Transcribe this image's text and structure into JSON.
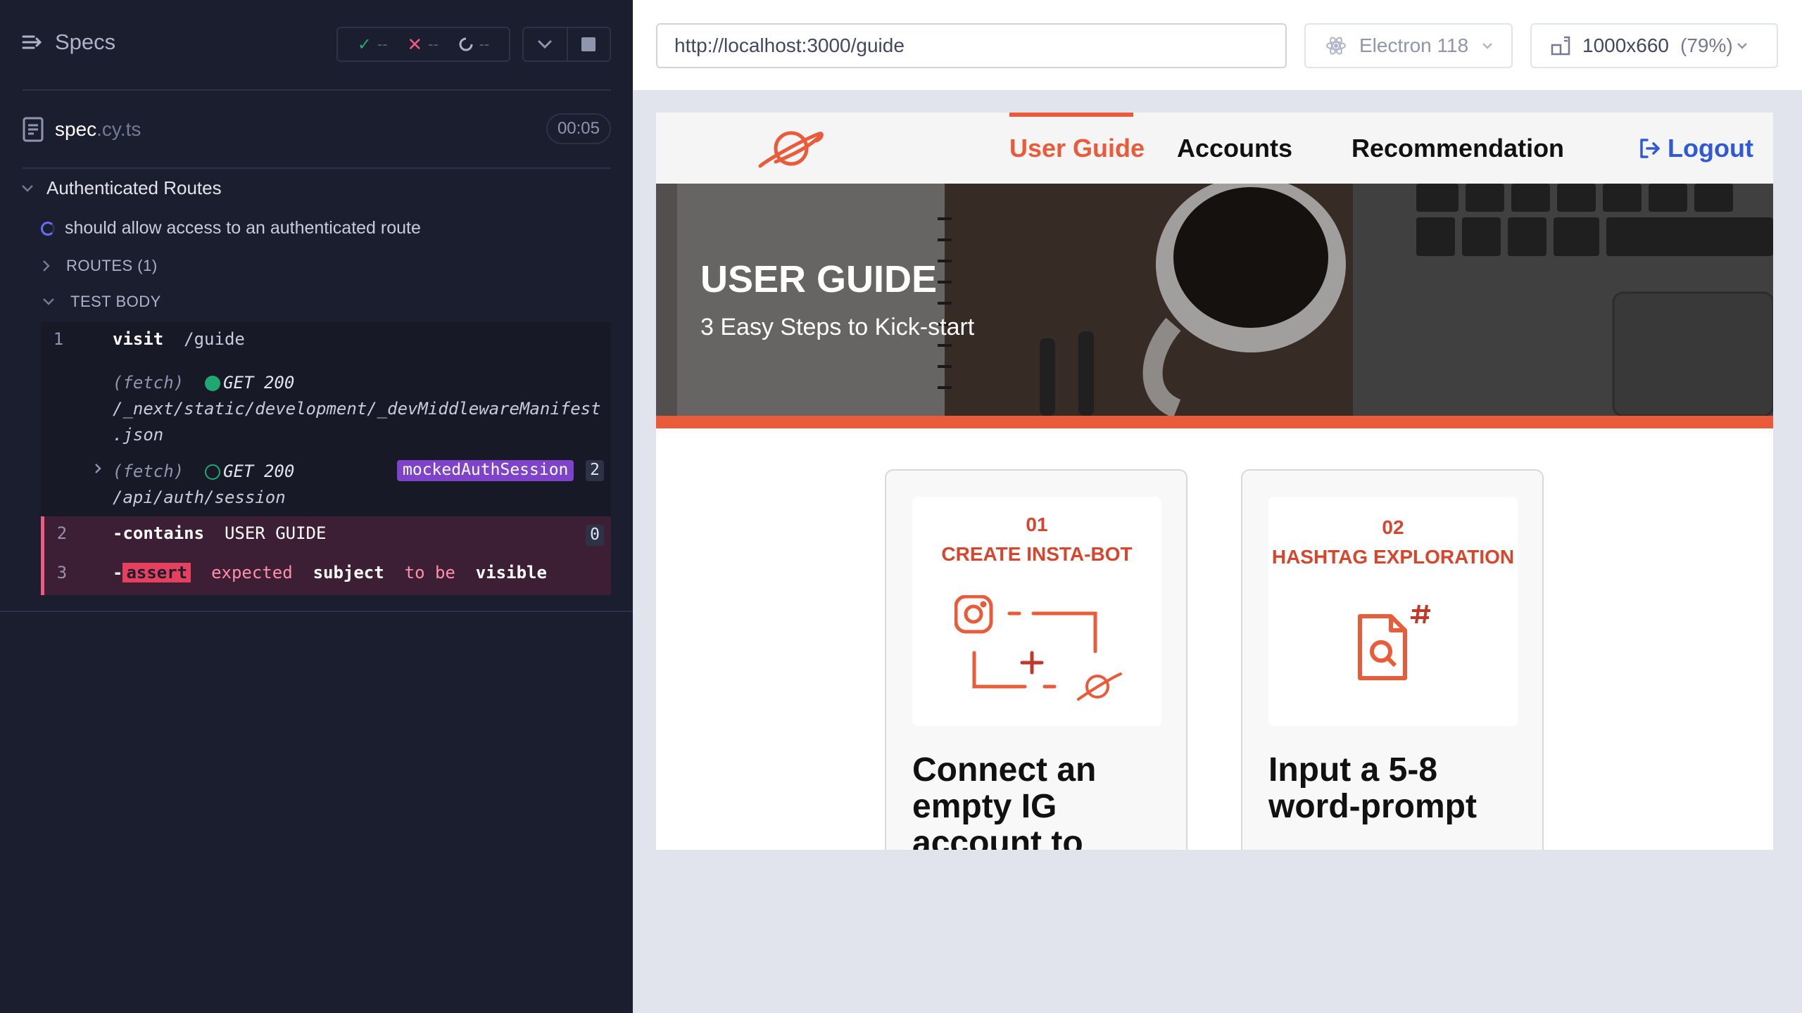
{
  "reporter": {
    "specs_label": "Specs",
    "stats": {
      "passed": "--",
      "failed": "--",
      "pending": "--"
    },
    "spec": {
      "name": "spec",
      "ext": ".cy.ts",
      "duration": "00:05"
    },
    "suite": {
      "title": "Authenticated Routes"
    },
    "test": {
      "title": "should allow access to an authenticated route"
    },
    "sections": {
      "routes": "ROUTES (1)",
      "test_body": "TEST BODY"
    },
    "commands": [
      {
        "num": "1",
        "name": "visit",
        "message": "/guide"
      },
      {
        "type": "(fetch)",
        "method": "GET 200",
        "url_line1": "/_next/static/development/_devMiddlewareManifest",
        "url_line2": ".json"
      },
      {
        "type": "(fetch)",
        "method": "GET 200",
        "url": "/api/auth/session",
        "alias": "mockedAuthSession",
        "count": "2"
      },
      {
        "num": "2",
        "name": "-contains",
        "message": "USER GUIDE",
        "count": "0"
      },
      {
        "num": "3",
        "name": "-assert",
        "message_parts": [
          "expected",
          "subject",
          "to be",
          "visible"
        ]
      }
    ]
  },
  "aut": {
    "url": "http://localhost:3000/guide",
    "browser": "Electron 118",
    "viewport": "1000x660",
    "zoom": "(79%)"
  },
  "site": {
    "nav": {
      "user_guide": "User Guide",
      "accounts": "Accounts",
      "recommendation": "Recommendation",
      "logout": "Logout"
    },
    "hero": {
      "title": "USER GUIDE",
      "subtitle": "3 Easy Steps to Kick-start"
    },
    "cards": [
      {
        "num": "01",
        "label": "CREATE INSTA-BOT",
        "title": "Connect an empty IG account to"
      },
      {
        "num": "02",
        "label": "HASHTAG EXPLORATION",
        "title": "Input a 5-8 word-prompt"
      }
    ]
  },
  "colors": {
    "reporter_bg": "#1b1e2e",
    "accent_orange": "#ea5b3a",
    "logout_blue": "#2f59d6",
    "pass_green": "#1fa971",
    "fail_pink": "#f05a7e",
    "alias_purple": "#7f43c9"
  }
}
